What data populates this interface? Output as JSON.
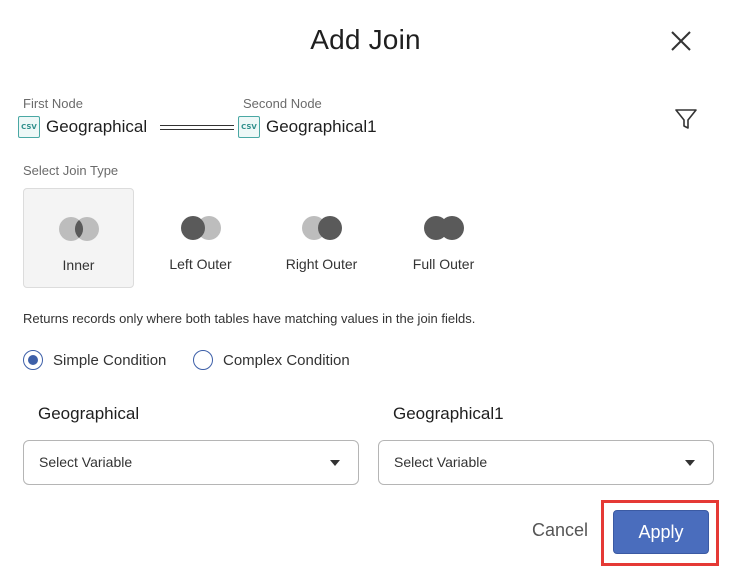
{
  "dialog": {
    "title": "Add Join",
    "close_icon": "close-icon",
    "filter_icon": "filter-icon"
  },
  "nodes": {
    "first_label": "First Node",
    "first_name": "Geographical",
    "second_label": "Second Node",
    "second_name": "Geographical1",
    "icon": "csv-file-icon",
    "icon_text": "CSV"
  },
  "join_type": {
    "section_label": "Select Join Type",
    "selected": "Inner",
    "options": [
      {
        "label": "Inner",
        "icon": "inner-join-icon"
      },
      {
        "label": "Left Outer",
        "icon": "left-outer-join-icon"
      },
      {
        "label": "Right Outer",
        "icon": "right-outer-join-icon"
      },
      {
        "label": "Full Outer",
        "icon": "full-outer-join-icon"
      }
    ],
    "description": "Returns records only where both tables have matching values in the join fields."
  },
  "condition": {
    "selected": "Simple Condition",
    "options": [
      "Simple Condition",
      "Complex Condition"
    ]
  },
  "fields": {
    "left_title": "Geographical",
    "right_title": "Geographical1",
    "left_select": "Select Variable",
    "right_select": "Select Variable"
  },
  "footer": {
    "cancel_label": "Cancel",
    "apply_label": "Apply"
  },
  "colors": {
    "primary": "#4a6dbd",
    "highlight": "#e53935",
    "join_dark": "#5a5a5a",
    "join_light": "#bdbdbd",
    "csv_accent": "#4aa8a4"
  }
}
